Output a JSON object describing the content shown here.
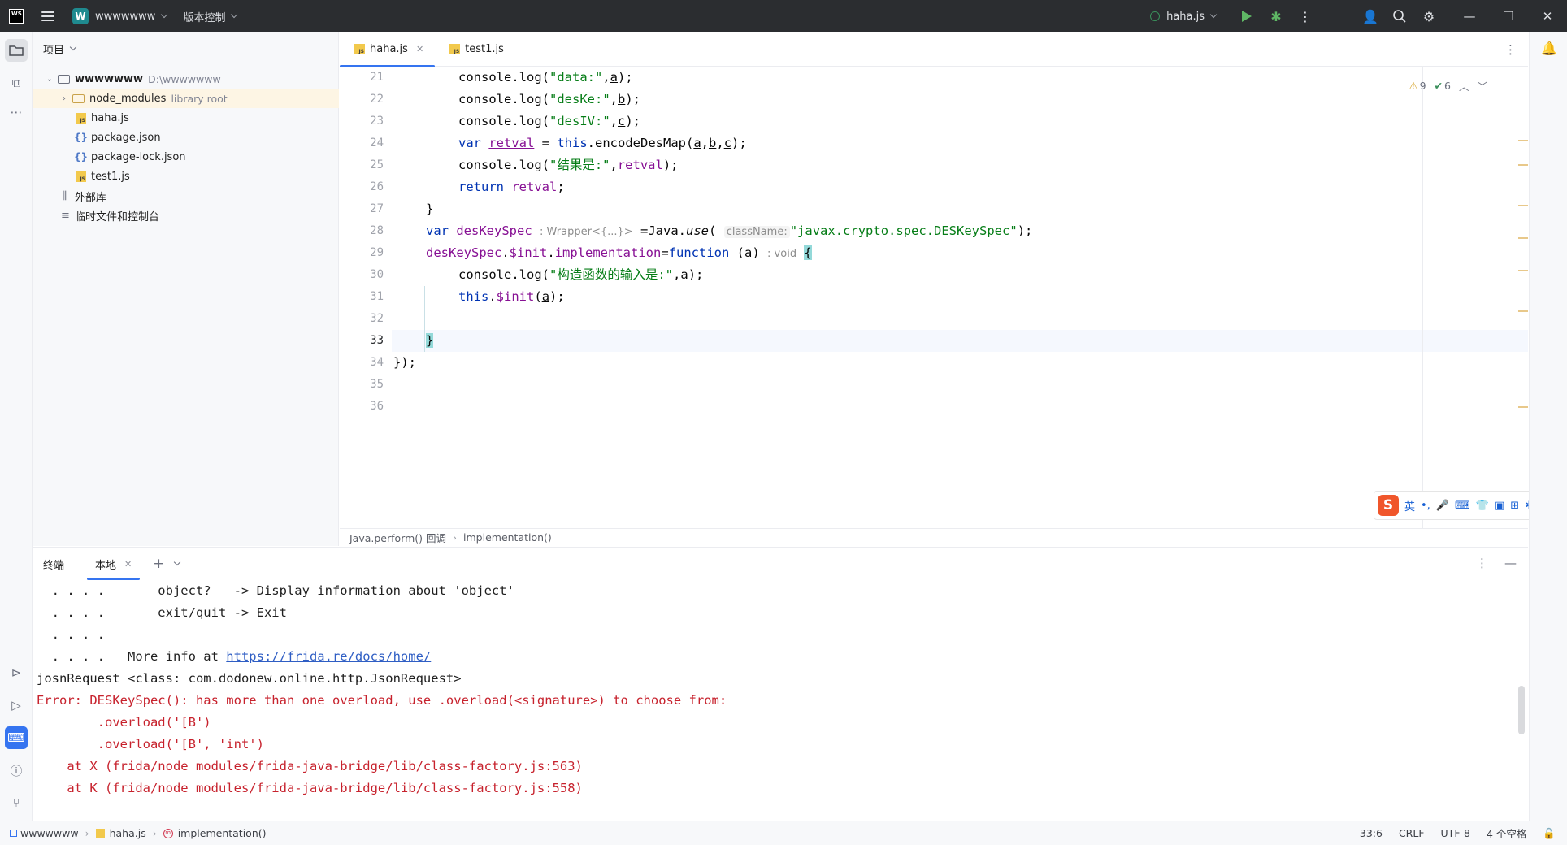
{
  "window": {
    "app_logo_text": "WS",
    "project_badge": "W",
    "project_name": "wwwwwww",
    "vcs_label": "版本控制",
    "run_config": "haha.js"
  },
  "project_panel": {
    "title": "项目",
    "tree": [
      {
        "label": "wwwwwww",
        "hint": "D:\\wwwwwww"
      },
      {
        "label": "node_modules",
        "hint": "library root"
      },
      {
        "label": "haha.js"
      },
      {
        "label": "package.json"
      },
      {
        "label": "package-lock.json"
      },
      {
        "label": "test1.js"
      },
      {
        "label": "外部库"
      },
      {
        "label": "临时文件和控制台"
      }
    ]
  },
  "editor": {
    "tabs": [
      {
        "label": "haha.js",
        "active": true
      },
      {
        "label": "test1.js",
        "active": false
      }
    ],
    "inspections": {
      "warnings": "9",
      "weak_warnings": "6"
    },
    "current_line": 33,
    "line_numbers": [
      "21",
      "22",
      "23",
      "24",
      "25",
      "26",
      "27",
      "28",
      "29",
      "30",
      "31",
      "32",
      "33",
      "34",
      "35",
      "36"
    ],
    "code": {
      "l21": {
        "a": "console.",
        "b": "log",
        "c": "(",
        "s": "\"data:\"",
        "d": ",",
        "p": "a",
        "e": ");"
      },
      "l22": {
        "a": "console.",
        "b": "log",
        "c": "(",
        "s": "\"desKe:\"",
        "d": ",",
        "p": "b",
        "e": ");"
      },
      "l23": {
        "a": "console.",
        "b": "log",
        "c": "(",
        "s": "\"desIV:\"",
        "d": ",",
        "p": "c",
        "e": ");"
      },
      "l24": {
        "kw": "var",
        "v": "retval",
        "eq": " = ",
        "th": "this",
        "m": ".encodeDesMap(",
        "p1": "a",
        "c1": ",",
        "p2": "b",
        "c2": ",",
        "p3": "c",
        "e": ");"
      },
      "l25": {
        "a": "console.",
        "b": "log",
        "c": "(",
        "s": "\"结果是:\"",
        "d": ",",
        "v": "retval",
        "e": ");"
      },
      "l26": {
        "kw": "return",
        "v": "retval",
        "e": ";"
      },
      "l27": {
        "t": "}"
      },
      "l28": {
        "kw": "var",
        "v": "desKeySpec",
        "hint": ": Wrapper<{...}>",
        "m": " =Java.",
        "u": "use",
        "o": "(",
        "hint2": "className:",
        "s": "\"javax.crypto.spec.DESKeySpec\"",
        "e": ");"
      },
      "l29": {
        "v": "desKeySpec",
        "d1": ".",
        "p1": "$init",
        "d2": ".",
        "p2": "implementation",
        "eq": "=",
        "kw": "function",
        "sp": " (",
        "a": "a",
        "cl": ")",
        "hint": ": void",
        "br": "{"
      },
      "l30": {
        "a": "console.",
        "b": "log",
        "c": "(",
        "s": "\"构造函数的输入是:\"",
        "d": ",",
        "p": "a",
        "e": ");"
      },
      "l31": {
        "th": "this",
        "d": ".",
        "p": "$init",
        "o": "(",
        "a": "a",
        "e": ");"
      },
      "l33": {
        "br": "}"
      },
      "l34": {
        "t": "});"
      }
    },
    "breadcrumb": [
      "Java.perform() 回调",
      "implementation()"
    ]
  },
  "ime": {
    "items": [
      "英",
      "•,",
      "🎤",
      "⌨",
      "👕",
      "▣",
      "⊞",
      "✲"
    ]
  },
  "terminal": {
    "title": "终端",
    "tab_label": "本地",
    "lines": [
      {
        "pre": "  . . . .       object?   -> Display information about 'object'"
      },
      {
        "pre": "  . . . .       exit/quit -> Exit"
      },
      {
        "pre": "  . . . ."
      },
      {
        "pre": "  . . . .   More info at ",
        "link": "https://frida.re/docs/home/"
      },
      {
        "pre": "josnRequest <class: com.dodonew.online.http.JsonRequest>"
      },
      {
        "pre": "Error: DESKeySpec(): has more than one overload, use .overload(<signature>) to choose from:",
        "err": true
      },
      {
        "pre": "        .overload('[B')",
        "err": true
      },
      {
        "pre": "        .overload('[B', 'int')",
        "err": true
      },
      {
        "pre": "    at X (frida/node_modules/frida-java-bridge/lib/class-factory.js:563)",
        "err": true
      },
      {
        "pre": "    at K (frida/node_modules/frida-java-bridge/lib/class-factory.js:558)",
        "err": true
      }
    ]
  },
  "statusbar": {
    "path": [
      "wwwwwww",
      "haha.js",
      "implementation()"
    ],
    "position": "33:6",
    "line_sep": "CRLF",
    "encoding": "UTF-8",
    "indent": "4 个空格"
  }
}
